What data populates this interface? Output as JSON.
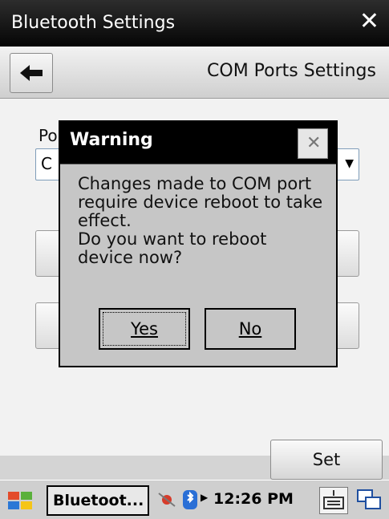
{
  "window": {
    "title": "Bluetooth Settings",
    "close_glyph": "✕"
  },
  "nav": {
    "page_title": "COM Ports Settings",
    "back_icon": "back-arrow-icon"
  },
  "form": {
    "port_label_partial": "Po",
    "port_select_partial": "C",
    "set_button_label": "Set"
  },
  "dialog": {
    "title": "Warning",
    "message": "Changes made to COM port require device reboot to take effect.\nDo you want to reboot device now?",
    "yes_label": "Yes",
    "no_label": "No"
  },
  "taskbar": {
    "task_label": "Bluetoot...",
    "clock": "12:26 PM"
  },
  "colors": {
    "titlebar": "#000000",
    "dialog_bg": "#c6c6c6",
    "content_bg": "#f2f2f2"
  }
}
